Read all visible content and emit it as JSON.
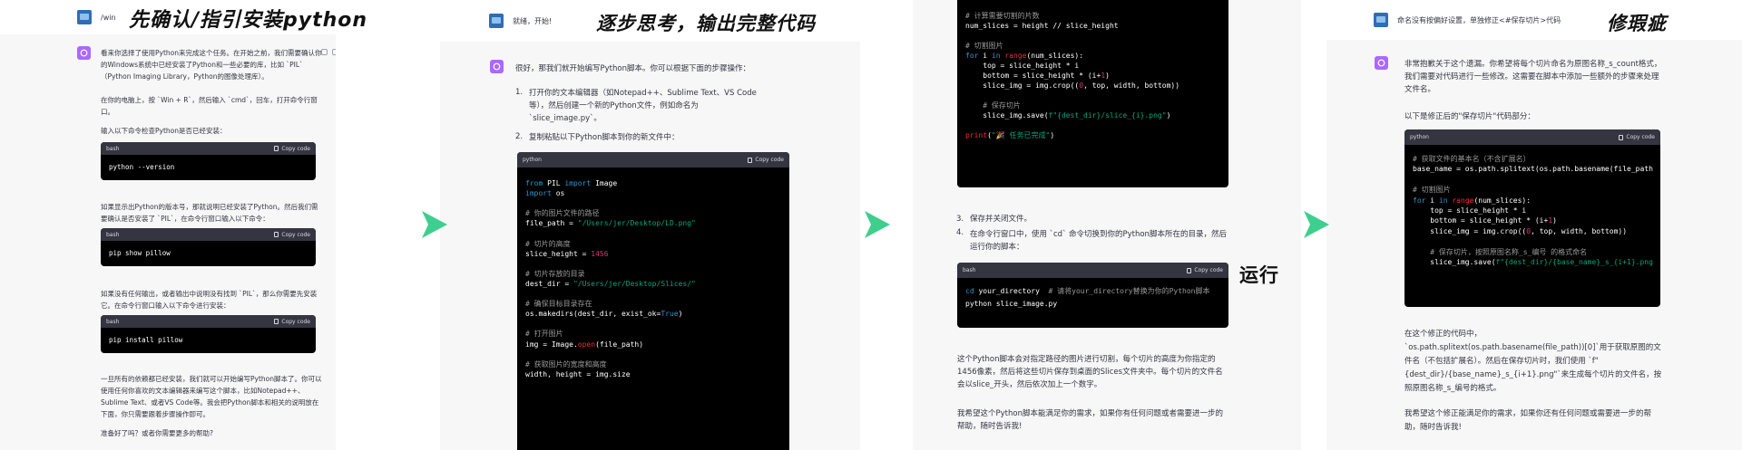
{
  "captions": {
    "step1": "先确认/指引安装python",
    "step2": "逐步思考，输出完整代码",
    "step3": "运行",
    "step4": "修瑕疵"
  },
  "colors": {
    "arrow": "#3ecf8e",
    "ai_avatar": "#ab68ff",
    "code_bg": "#000000",
    "code_header": "#343541",
    "keyword": "#2e95d3",
    "string": "#00a67d",
    "number": "#df3079",
    "comment": "#999999"
  },
  "panel1": {
    "user_message": "/win",
    "reply": {
      "p1": "看来你选择了使用Python来完成这个任务。在开始之前，我们需要确认你的Windows系统中已经安装了Python和一些必要的库，比如",
      "p1b": "`PIL`（Python Imaging Library，Python的图像处理库）。",
      "p2": "在你的电脑上，按 `Win + R`，然后输入 `cmd`，回车，打开命令行窗口。",
      "p3": "输入以下命令检查Python是否已经安装：",
      "p4": "如果显示出Python的版本号，那就说明已经安装了Python。然后我们需要确认是否安装了 `PIL`，在命令行窗口输入以下命令：",
      "p5": "如果没有任何输出，或者输出中说明没有找到 `PIL`，那么你需要先安装它。在命令行窗口输入以下命令进行安装：",
      "p6": "一旦所有的依赖都已经安装，我们就可以开始编写Python脚本了。你可以使用任何你喜欢的文本编辑器来编写这个脚本，比如Notepad++、Sublime Text、或者VS Code等。我会把Python脚本和相关的说明放在下面，你只需要跟着步骤操作即可。",
      "p7": "准备好了吗？或者你需要更多的帮助?"
    },
    "code_blocks": [
      {
        "lang": "bash",
        "copy": "Copy code",
        "code": "python --version"
      },
      {
        "lang": "bash",
        "copy": "Copy code",
        "code": "pip show pillow"
      },
      {
        "lang": "bash",
        "copy": "Copy code",
        "code": "pip install pillow"
      }
    ]
  },
  "panel2": {
    "user_message": "就绪，开始!",
    "reply_intro": "很好，那我们就开始编写Python脚本。你可以根据下面的步骤操作：",
    "steps": [
      {
        "num": "1.",
        "text": "打开你的文本编辑器（如Notepad++、Sublime Text、VS Code等），然后创建一个新的Python文件，例如命名为"
      },
      {
        "num": "",
        "text": "`slice_image.py`。"
      },
      {
        "num": "2.",
        "text": "复制粘贴以下Python脚本到你的新文件中："
      }
    ],
    "code": {
      "lang": "python",
      "copy": "Copy code"
    },
    "code_lines": {
      "l1_from": "from",
      "l1_mod": " PIL ",
      "l1_import": "import",
      "l1_name": " Image",
      "l2_import": "import",
      "l2_mod": " os",
      "c1": "# 你的图片文件的路径",
      "l3_var": "file_path = ",
      "l3_str": "\"/Users/jer/Desktop/LD.png\"",
      "c2": "# 切片的高度",
      "l4_var": "slice_height = ",
      "l4_num": "1456",
      "c3": "# 切片存放的目录",
      "l5_var": "dest_dir = ",
      "l5_str": "\"/Users/jer/Desktop/Slices/\"",
      "c4": "# 确保目标目录存在",
      "l6_a": "os.makedirs(dest_dir, exist_ok=",
      "l6_true": "True",
      "l6_b": ")",
      "c5": "# 打开图片",
      "l7_a": "img = Image.",
      "l7_fn": "open",
      "l7_b": "(file_path)",
      "c6": "# 获取图片的宽度和高度",
      "l8": "width, height = img.size"
    }
  },
  "panel3": {
    "code_lines": {
      "c1": "# 计算需要切割的片数",
      "l1": "num_slices = height // slice_height",
      "c2": "# 切割图片",
      "l2_for": "for",
      "l2_a": " i ",
      "l2_in": "in",
      "l2_fn": " range",
      "l2_b": "(num_slices):",
      "l3_a": "    top = slice_height * i",
      "l4_a": "    bottom = slice_height * (i+",
      "l4_num": "1",
      "l4_b": ")",
      "l5_a": "    slice_img = img.crop((",
      "l5_num": "0",
      "l5_b": ", top, width, bottom))",
      "c3": "    # 保存切片",
      "l6_a": "    slice_img.save(",
      "l6_str": "f\"{dest_dir}/slice_{i}.png\"",
      "l6_b": ")",
      "l7_fn": "print",
      "l7_a": "(",
      "l7_str": "\"🎉 任务已完成\"",
      "l7_b": ")"
    },
    "steps": [
      {
        "num": "3.",
        "text": "保存并关闭文件。"
      },
      {
        "num": "4.",
        "text": "在命令行窗口中，使用 `cd` 命令切换到你的Python脚本所在的目录，然后运行你的脚本："
      }
    ],
    "code": {
      "lang": "bash",
      "copy": "Copy code"
    },
    "bash_lines": {
      "l1_cmd": "cd",
      "l1_a": " your_directory  ",
      "l1_cm": "# 请将your_directory替换为你的Python脚本",
      "l2": "python slice_image.py"
    },
    "p1": "这个Python脚本会对指定路径的图片进行切割，每个切片的高度为你指定的1456像素，然后将这些切片保存到桌面的Slices文件夹中。每个切片的文件名会以slice_开头，然后依次加上一个数字。",
    "p2": "我希望这个Python脚本能满足你的需求，如果你有任何问题或者需要进一步的帮助，随时告诉我!"
  },
  "panel4": {
    "user_message": "命名没有按偏好设置，单独修正<#保存切片>代码",
    "reply": {
      "p1": "非常抱歉关于这个遗漏。你希望将每个切片命名为原图名称_s_count格式，我们需要对代码进行一些修改。这需要在脚本中添加一些额外的步骤来处理文件名。",
      "p2": "以下是修正后的\"保存切片\"代码部分：",
      "p3": "在这个修正的代码中，",
      "p3b": "`os.path.splitext(os.path.basename(file_path))[0]`用于获取原图的文件名（不包括扩展名）。然后在保存切片时，我们使用",
      "p3c": "`f\"{dest_dir}/{base_name}_s_{i+1}.png\"`来生成每个切片的文件名，按照原图名称_s_编号的格式。",
      "p4": "我希望这个修正能满足你的需求，如果你还有任何问题或需要进一步的帮助，随时告诉我!"
    },
    "code": {
      "lang": "python",
      "copy": "Copy code"
    },
    "code_lines": {
      "c1": "# 获取文件的基本名（不含扩展名）",
      "l1": "base_name = os.path.splitext(os.path.basename(file_path",
      "c2": "# 切割图片",
      "l2_for": "for",
      "l2_a": " i ",
      "l2_in": "in",
      "l2_fn": " range",
      "l2_b": "(num_slices):",
      "l3": "    top = slice_height * i",
      "l4_a": "    bottom = slice_height * (i+",
      "l4_num": "1",
      "l4_b": ")",
      "l5_a": "    slice_img = img.crop((",
      "l5_num": "0",
      "l5_b": ", top, width, bottom))",
      "c3": "    # 保存切片，按照原图名称_s_编号 的格式命名",
      "l6_a": "    slice_img.save(",
      "l6_str": "f\"{dest_dir}/{base_name}_s_{i+1}.png"
    }
  }
}
